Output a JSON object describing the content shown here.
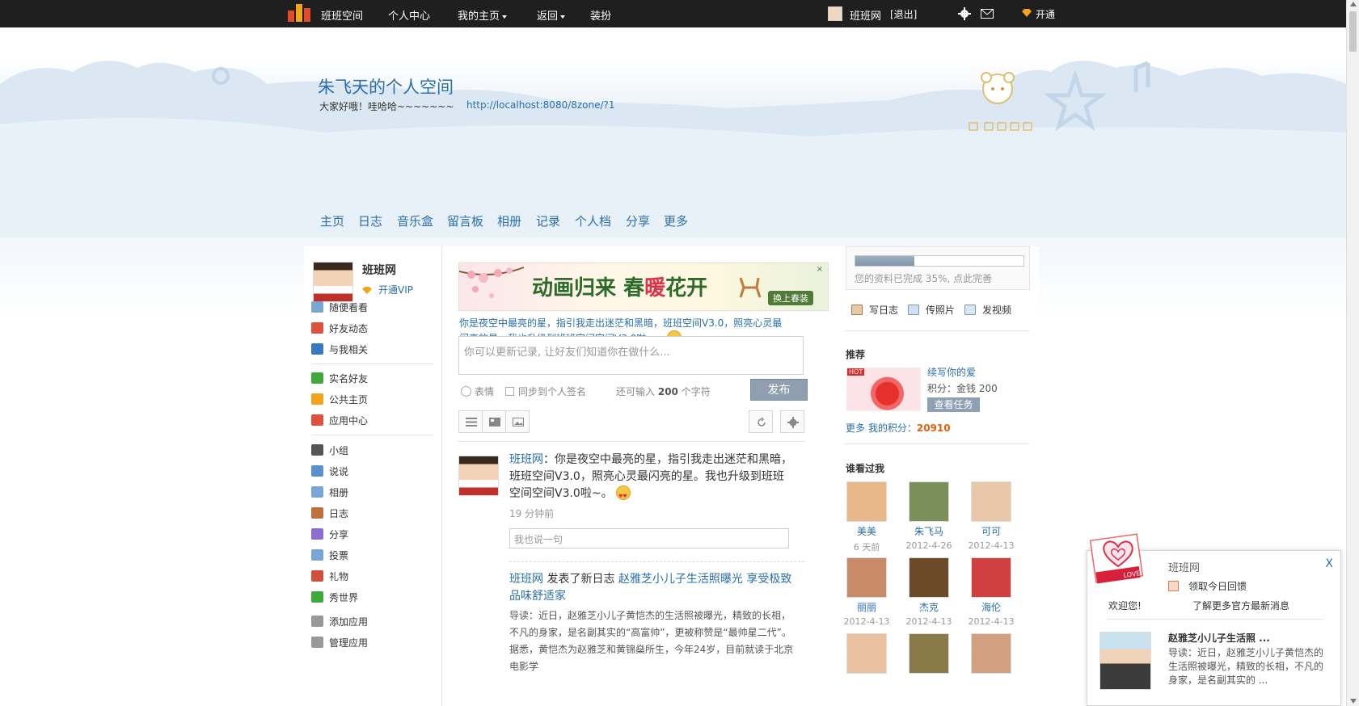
{
  "topbar": {
    "brand": "班班空间",
    "nav": [
      "个人中心",
      "我的主页",
      "返回",
      "装扮"
    ],
    "username": "班班网",
    "logout": "[退出]",
    "open": "开通"
  },
  "header": {
    "title": "朱飞天的个人空间",
    "motto": "大家好哦！哇哈哈~~~~~~~",
    "url": "http://localhost:8080/8zone/?1"
  },
  "space_nav": [
    "主页",
    "日志",
    "音乐盒",
    "留言板",
    "相册",
    "记录",
    "个人档",
    "分享",
    "更多"
  ],
  "sidebar": {
    "name": "班班网",
    "vip": "开通VIP",
    "items": [
      {
        "label": "随便看看",
        "color": "#7aa6d6"
      },
      {
        "label": "好友动态",
        "color": "#e0503c"
      },
      {
        "label": "与我相关",
        "color": "#3a78c0"
      },
      {
        "label": "实名好友",
        "color": "#3faa3a"
      },
      {
        "label": "公共主页",
        "color": "#f2a51a"
      },
      {
        "label": "应用中心",
        "color": "#e0503c"
      },
      {
        "label": "小组",
        "color": "#555555"
      },
      {
        "label": "说说",
        "color": "#5a8fd0"
      },
      {
        "label": "相册",
        "color": "#7aa6d6"
      },
      {
        "label": "日志",
        "color": "#c0703a"
      },
      {
        "label": "分享",
        "color": "#8a6fd0"
      },
      {
        "label": "投票",
        "color": "#7aa6d6"
      },
      {
        "label": "礼物",
        "color": "#d0503c"
      },
      {
        "label": "秀世界",
        "color": "#3faa3a"
      },
      {
        "label": "添加应用",
        "color": "#999999"
      },
      {
        "label": "管理应用",
        "color": "#999999"
      }
    ]
  },
  "banner": {
    "text_a": "动画归来",
    "text_b": "春",
    "text_c": "暖",
    "text_d": "花开",
    "skin_button": "换上春装",
    "close": "×"
  },
  "status": {
    "tip": "你是夜空中最亮的星，指引我走出迷茫和黑暗，班班空间V3.0，照亮心灵最闪亮的星。我也升级到班班空间空间V3.0啦~。",
    "placeholder": "你可以更新记录, 让好友们知道你在做什么...",
    "emote": "表情",
    "sync": "同步到个人签名",
    "counter_prefix": "还可输入",
    "counter_num": "200",
    "counter_suffix": "个字符",
    "publish": "发布"
  },
  "feed": {
    "item1": {
      "who": "班班网",
      "text": "：你是夜空中最亮的星，指引我走出迷茫和黑暗，班班空间V3.0，照亮心灵最闪亮的星。我也升级到班班空间空间V3.0啦~。",
      "time": "19 分钟前",
      "reply_placeholder": "我也说一句"
    },
    "item2": {
      "who": "班班网",
      "action": " 发表了新日志 ",
      "title": "赵雅芝小儿子生活照曝光 享受极致品味舒适家",
      "body": "导读：近日，赵雅芝小儿子黄恺杰的生活照被曝光，精致的长相，不凡的身家，是名副其实的“高富帅”，更被称赞是“最帅星二代”。    据悉，黄恺杰为赵雅芝和黄锦燊所生，今年24岁，目前就读于北京电影学"
    }
  },
  "right": {
    "profile_progress": 0.35,
    "profile_text": "您的资料已完成 35%, 点此完善",
    "actions": [
      "写日志",
      "传照片",
      "发视频"
    ],
    "recommend_title": "推荐",
    "rec_hot": "HOT",
    "rec_name": "续写你的爱",
    "rec_points": "积分：金钱 200",
    "rec_button": "查看任务",
    "more": "更多",
    "my_points_label": "我的积分：",
    "my_points": "20910",
    "visitors_title": "谁看过我",
    "visitors": [
      {
        "name": "美美",
        "date": "6 天前",
        "color": "#e8b88a"
      },
      {
        "name": "朱飞马",
        "date": "2012-4-26",
        "color": "#7a8f5a"
      },
      {
        "name": "可可",
        "date": "2012-4-13",
        "color": "#e9c7a8"
      },
      {
        "name": "丽丽",
        "date": "2012-4-13",
        "color": "#c98a6a"
      },
      {
        "name": "杰克",
        "date": "2012-4-13",
        "color": "#6b4a2a"
      },
      {
        "name": "海伦",
        "date": "2012-4-13",
        "color": "#d04040"
      }
    ]
  },
  "popup": {
    "brand": "班班网",
    "close": "X",
    "gift": "领取今日回馈",
    "welcome": "欢迎您!",
    "more": "了解更多官方最新消息",
    "title": "赵雅芝小儿子生活照 ...",
    "body": "导读：近日，赵雅芝小儿子黄恺杰的生活照被曝光，精致的长相，不凡的身家，是名副其实的 ...",
    "love": "LOVE"
  }
}
